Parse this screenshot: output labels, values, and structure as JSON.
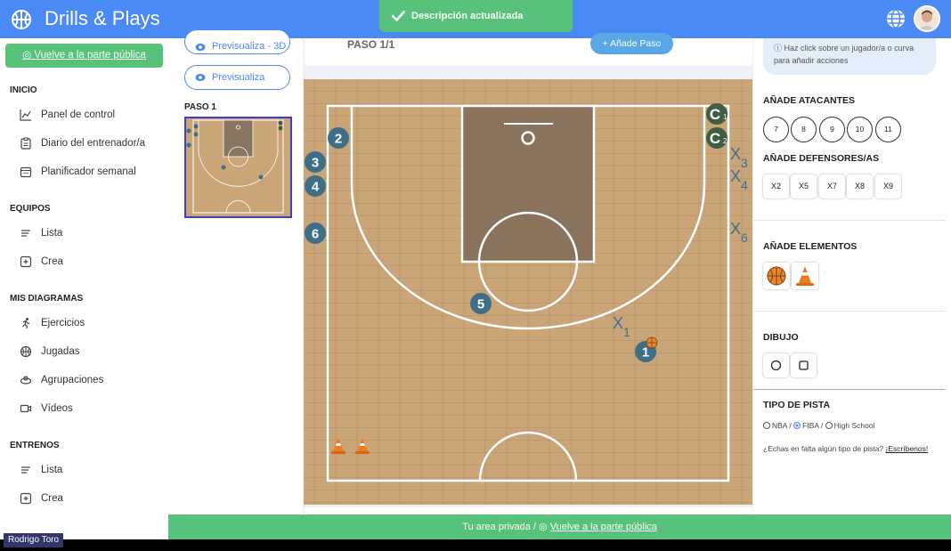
{
  "app": {
    "title": "Drills & Plays"
  },
  "toast": {
    "message": "Descripción actualizada"
  },
  "sidebar": {
    "public_link": "Vuelve a la parte pública",
    "sections": {
      "inicio": "INICIO",
      "equipos": "EQUIPOS",
      "diagramas": "MIS DIAGRAMAS",
      "entrenos": "ENTRENOS"
    },
    "items": {
      "panel": "Panel de control",
      "diario": "Diario del entrenador/a",
      "planificador": "Planificador semanal",
      "equipos_lista": "Lista",
      "equipos_crea": "Crea",
      "ejercicios": "Ejercicios",
      "jugadas": "Jugadas",
      "agrupaciones": "Agrupaciones",
      "videos": "Vídeos",
      "entrenos_lista": "Lista",
      "entrenos_crea": "Crea"
    }
  },
  "steps": {
    "preview_3d": "Previsualiza - 3D",
    "preview": "Previsualiza",
    "step_label": "PASO 1"
  },
  "editor": {
    "step_counter": "PASO 1/1",
    "add_step": "+ Añade Paso"
  },
  "court": {
    "players": [
      {
        "label": "2"
      },
      {
        "label": "3"
      },
      {
        "label": "4"
      },
      {
        "label": "6"
      },
      {
        "label": "5"
      },
      {
        "label": "1"
      }
    ],
    "coaches": [
      {
        "label": "C",
        "sub": "1"
      },
      {
        "label": "C",
        "sub": "2"
      }
    ],
    "defenders": [
      {
        "label": "X",
        "sub": "3"
      },
      {
        "label": "X",
        "sub": "4"
      },
      {
        "label": "X",
        "sub": "6"
      },
      {
        "label": "X",
        "sub": "1"
      }
    ],
    "colors": {
      "wood": "#c9a578",
      "paint": "#7f6a58",
      "player": "#3f6f87",
      "coach": "#3f5e44",
      "defender": "#3e6d93"
    }
  },
  "right_panel": {
    "hint": "Haz click sobre un jugador/a o curva para añadir acciones",
    "attackers_title": "AÑADE ATACANTES",
    "attackers": [
      "7",
      "8",
      "9",
      "10",
      "11"
    ],
    "defenders_title": "AÑADE DEFENSORES/AS",
    "defenders": [
      "X2",
      "X5",
      "X7",
      "X8",
      "X9"
    ],
    "elements_title": "AÑADE ELEMENTOS",
    "elements": [
      "basketball-icon",
      "cone-icon"
    ],
    "draw_title": "DIBUJO",
    "court_type_title": "TIPO DE PISTA",
    "court_types": {
      "nba": "NBA",
      "sep1": " / ",
      "fiba": "FIBA",
      "sep2": " / ",
      "hs": "High School",
      "selected": "FIBA"
    },
    "ask_text": "¿Echas en falta algún tipo de pista?",
    "ask_link": "¡Escríbenos!"
  },
  "footer": {
    "text": "Tu area privada /",
    "link": "Vuelve a la parte pública"
  },
  "video": {
    "name_tag": "Rodrigo Toro"
  }
}
